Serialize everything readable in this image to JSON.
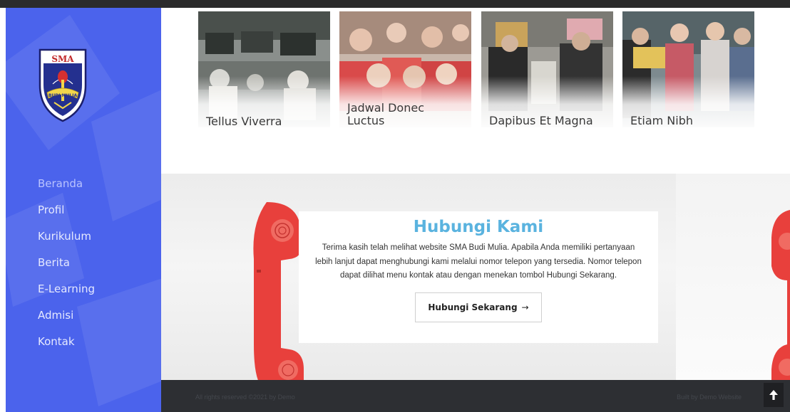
{
  "sidebar": {
    "logo": {
      "top_text": "SMA",
      "ribbon_text": "BUDI MULIA",
      "icon": "school-crest-icon"
    },
    "nav": [
      {
        "label": "Beranda"
      },
      {
        "label": "Profil"
      },
      {
        "label": "Kurikulum"
      },
      {
        "label": "Berita"
      },
      {
        "label": "E-Learning"
      },
      {
        "label": "Admisi"
      },
      {
        "label": "Kontak"
      }
    ]
  },
  "gallery": {
    "cards": [
      {
        "caption": "Tellus Viverra"
      },
      {
        "caption": "Jadwal Donec Luctus"
      },
      {
        "caption": "Dapibus Et Magna"
      },
      {
        "caption": "Etiam Nibh"
      }
    ]
  },
  "contact": {
    "title": "Hubungi Kami",
    "text": "Terima kasih telah melihat website SMA Budi Mulia. Apabila Anda memiliki pertanyaan lebih lanjut dapat menghubungi kami melalui nomor telepon yang tersedia. Nomor telepon dapat dilihat menu kontak atau dengan menekan tombol Hubungi Sekarang.",
    "button_label": "Hubungi Sekarang",
    "button_arrow": "→"
  },
  "footer": {
    "copyright": "All rights reserved ©2021 by Demo",
    "credit": "Built by Demo Website",
    "scroll_top_icon": "arrow-up-icon"
  },
  "colors": {
    "sidebar": "#4b63ec",
    "title": "#5ab3df",
    "footer": "#2d2f33",
    "phone": "#e8403c"
  }
}
